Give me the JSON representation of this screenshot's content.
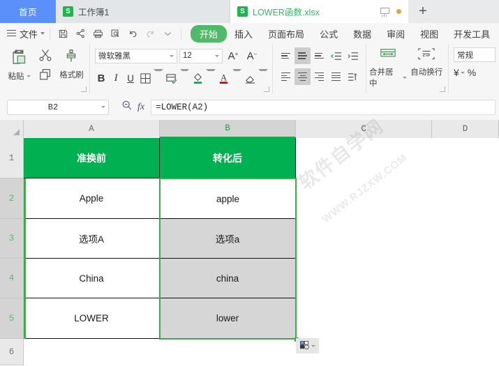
{
  "tabbar": {
    "home_tab": "首页",
    "tabs": [
      {
        "label": "工作簿1",
        "logo": "S",
        "active": false
      },
      {
        "label": "LOWER函数.xlsx",
        "logo": "S",
        "active": true
      }
    ],
    "new_tab": "+",
    "icons": {
      "monitor": "monitor-icon",
      "unsaved": "unsaved-dot-icon"
    }
  },
  "menubar": {
    "file_label": "文件",
    "quick_access": [
      "save-icon",
      "share-icon",
      "print-icon",
      "print-preview-icon",
      "undo-icon",
      "redo-icon",
      "customize-dropdown-icon"
    ],
    "ribbon_tabs": [
      {
        "label": "开始",
        "active": true
      },
      {
        "label": "插入",
        "active": false
      },
      {
        "label": "页面布局",
        "active": false
      },
      {
        "label": "公式",
        "active": false
      },
      {
        "label": "数据",
        "active": false
      },
      {
        "label": "审阅",
        "active": false
      },
      {
        "label": "视图",
        "active": false
      },
      {
        "label": "开发工具",
        "active": false
      }
    ]
  },
  "ribbon": {
    "clipboard": {
      "paste_label": "粘贴",
      "copy_icon": "copy-icon",
      "cut_icon": "cut-icon",
      "format_painter_label": "格式刷"
    },
    "font": {
      "font_name": "微软雅黑",
      "font_size": "12",
      "grow_font": "A",
      "shrink_font": "A",
      "bold": "B",
      "italic": "I",
      "underline": "U",
      "borders_icon": "borders-icon",
      "cell_style_icon": "cell-style-icon",
      "fill_color_icon": "fill-color-icon",
      "font_color_icon": "font-color-icon",
      "clear_format_icon": "clear-format-icon"
    },
    "alignment": {
      "align_top_icon": "align-top-icon",
      "align_middle_icon": "align-middle-icon",
      "align_bottom_icon": "align-bottom-icon",
      "decrease_indent_icon": "decrease-indent-icon",
      "increase_indent_icon": "increase-indent-icon",
      "align_left_icon": "align-left-icon",
      "align_center_icon": "align-center-icon",
      "align_right_icon": "align-right-icon",
      "justify_icon": "justify-icon",
      "orientation_icon": "text-orientation-icon",
      "merge_label": "合并居中",
      "wrap_label": "自动换行"
    },
    "number": {
      "format_value": "常规",
      "currency_icon": "¥",
      "percent_icon": "%"
    }
  },
  "formula_bar": {
    "name_box_value": "B2",
    "zoom_icon": "search-icon",
    "fx_label": "fx",
    "formula_value": "=LOWER(A2)"
  },
  "grid": {
    "columns": [
      {
        "label": "A",
        "width": 195,
        "selected": false
      },
      {
        "label": "B",
        "width": 195,
        "selected": true
      },
      {
        "label": "C",
        "width": 195,
        "selected": false
      },
      {
        "label": "D",
        "width": 96,
        "selected": false
      }
    ],
    "rows": [
      {
        "label": "1",
        "height": 58,
        "selected": false
      },
      {
        "label": "2",
        "height": 58,
        "selected": true
      },
      {
        "label": "3",
        "height": 57,
        "selected": true
      },
      {
        "label": "4",
        "height": 57,
        "selected": true
      },
      {
        "label": "5",
        "height": 58,
        "selected": true
      },
      {
        "label": "6",
        "height": 38,
        "selected": false
      }
    ],
    "cells": [
      [
        "准换前",
        "转化后",
        "",
        ""
      ],
      [
        "Apple",
        "apple",
        "",
        ""
      ],
      [
        "选项A",
        "选项a",
        "",
        ""
      ],
      [
        "China",
        "china",
        "",
        ""
      ],
      [
        "LOWER",
        "lower",
        "",
        ""
      ],
      [
        "",
        "",
        "",
        ""
      ]
    ],
    "header_row_index": 0,
    "active_cell": "B2",
    "selected_range": "B2:B5",
    "quick_analysis_icon": "quick-analysis-icon",
    "colors": {
      "header_green": "#01b050",
      "selection_green": "#3fa94d",
      "selected_fill": "#d6d6d6"
    }
  },
  "watermark": {
    "line1": "软件自学网",
    "line2": "WWW.RJZXW.COM"
  }
}
